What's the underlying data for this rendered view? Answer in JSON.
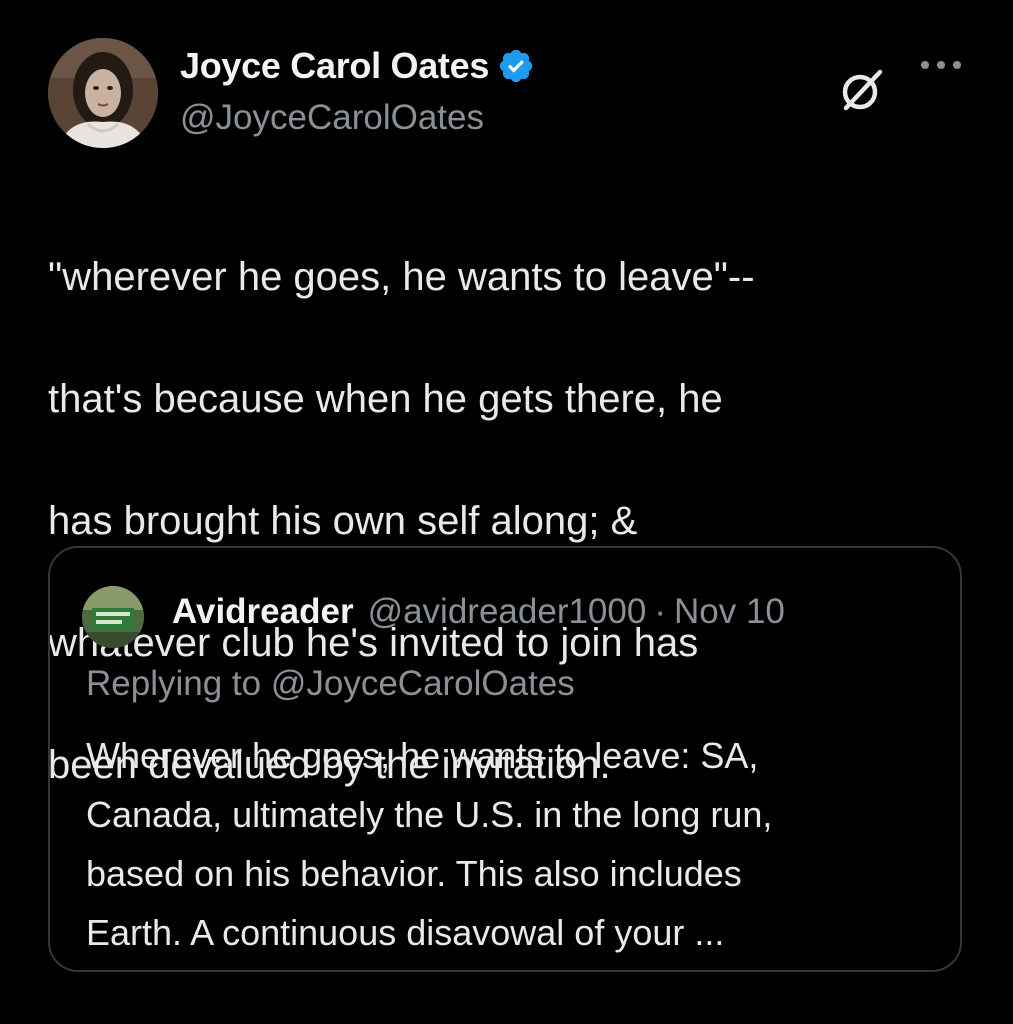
{
  "author": {
    "name": "Joyce Carol Oates",
    "handle": "@JoyceCarolOates",
    "verified_icon": "verified-badge-icon",
    "verified_color": "#1d9bf0"
  },
  "actions": {
    "grok_icon": "grok-icon",
    "more_icon": "more-options-icon"
  },
  "tweet": {
    "lines": [
      "\"wherever he goes, he wants to leave\"--",
      "that's because when he gets there, he",
      "has brought his own self along; &",
      "whatever club he's invited to join has",
      "been devalued by the invitation."
    ]
  },
  "quote": {
    "name": "Avidreader",
    "handle": "@avidreader1000",
    "separator": "·",
    "date": "Nov 10",
    "replying_to": "Replying to @JoyceCarolOates",
    "lines": [
      "Wherever he goes, he wants to leave: SA,",
      "Canada, ultimately the U.S. in the long run,",
      "based on his behavior. This also includes",
      "Earth. A continuous disavowal of your ..."
    ]
  },
  "colors": {
    "background": "#000000",
    "text": "#e7e9ea",
    "secondary_text": "#8b9096",
    "border": "#33373b",
    "accent": "#1d9bf0"
  }
}
